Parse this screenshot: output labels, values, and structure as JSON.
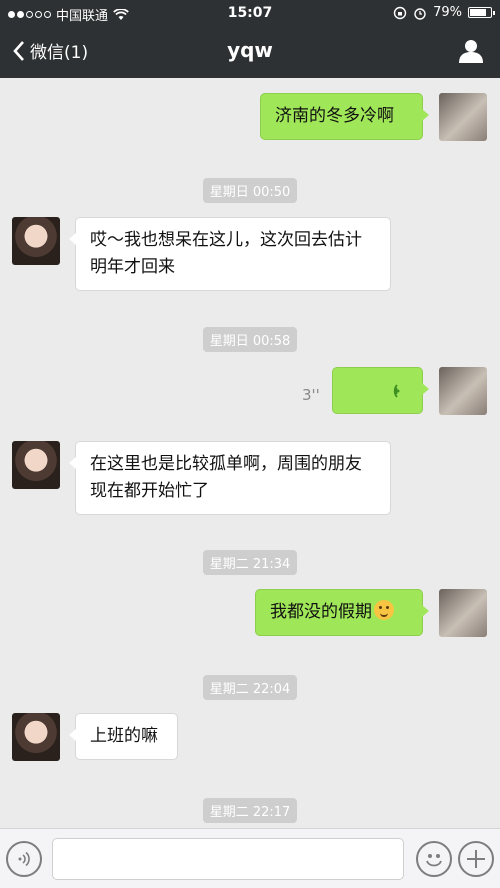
{
  "statusbar": {
    "carrier": "中国联通",
    "time": "15:07",
    "battery": "79%",
    "battery_level": 0.79
  },
  "navbar": {
    "back_label": "微信(1)",
    "title": "yqw"
  },
  "messages": [
    {
      "type": "text",
      "sender": "me",
      "text": "济南的冬多冷啊"
    },
    {
      "type": "timestamp",
      "text": "星期日 00:50"
    },
    {
      "type": "text",
      "sender": "other",
      "text": "哎～我也想呆在这儿，这次回去估计明年才回来"
    },
    {
      "type": "timestamp",
      "text": "星期日 00:58"
    },
    {
      "type": "voice",
      "sender": "me",
      "duration": "3''"
    },
    {
      "type": "text",
      "sender": "other",
      "text": "在这里也是比较孤单啊，周围的朋友现在都开始忙了"
    },
    {
      "type": "timestamp",
      "text": "星期二 21:34"
    },
    {
      "type": "text",
      "sender": "me",
      "text": "我都没的假期",
      "emoji": "smile-emoji"
    },
    {
      "type": "timestamp",
      "text": "星期二 22:04"
    },
    {
      "type": "text",
      "sender": "other",
      "text": "上班的嘛"
    },
    {
      "type": "timestamp",
      "text": "星期二 22:17"
    }
  ],
  "input": {
    "placeholder": "",
    "value": ""
  },
  "icons": {
    "voice_toggle": "voice-toggle-icon",
    "emoji": "emoji-icon",
    "add": "add-icon",
    "profile": "profile-icon",
    "back": "chevron-left-icon"
  },
  "colors": {
    "header_bg": "#2e3133",
    "my_bubble": "#9fe658",
    "their_bubble": "#ffffff",
    "chat_bg": "#ebebeb"
  }
}
